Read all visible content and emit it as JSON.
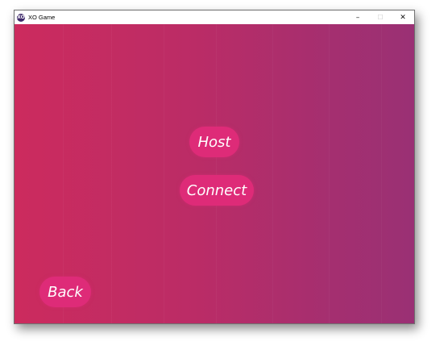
{
  "window": {
    "title": "XO Game",
    "icon": "app-logo-icon",
    "controls": {
      "minimize": "–",
      "maximize": "☐",
      "close": "✕"
    }
  },
  "colors": {
    "gradient_left": "#cc2b5e",
    "gradient_right": "#9a3074",
    "button_bg": "#de2b78",
    "button_text": "#ffffff"
  },
  "menu": {
    "host_label": "Host",
    "connect_label": "Connect",
    "back_label": "Back"
  }
}
